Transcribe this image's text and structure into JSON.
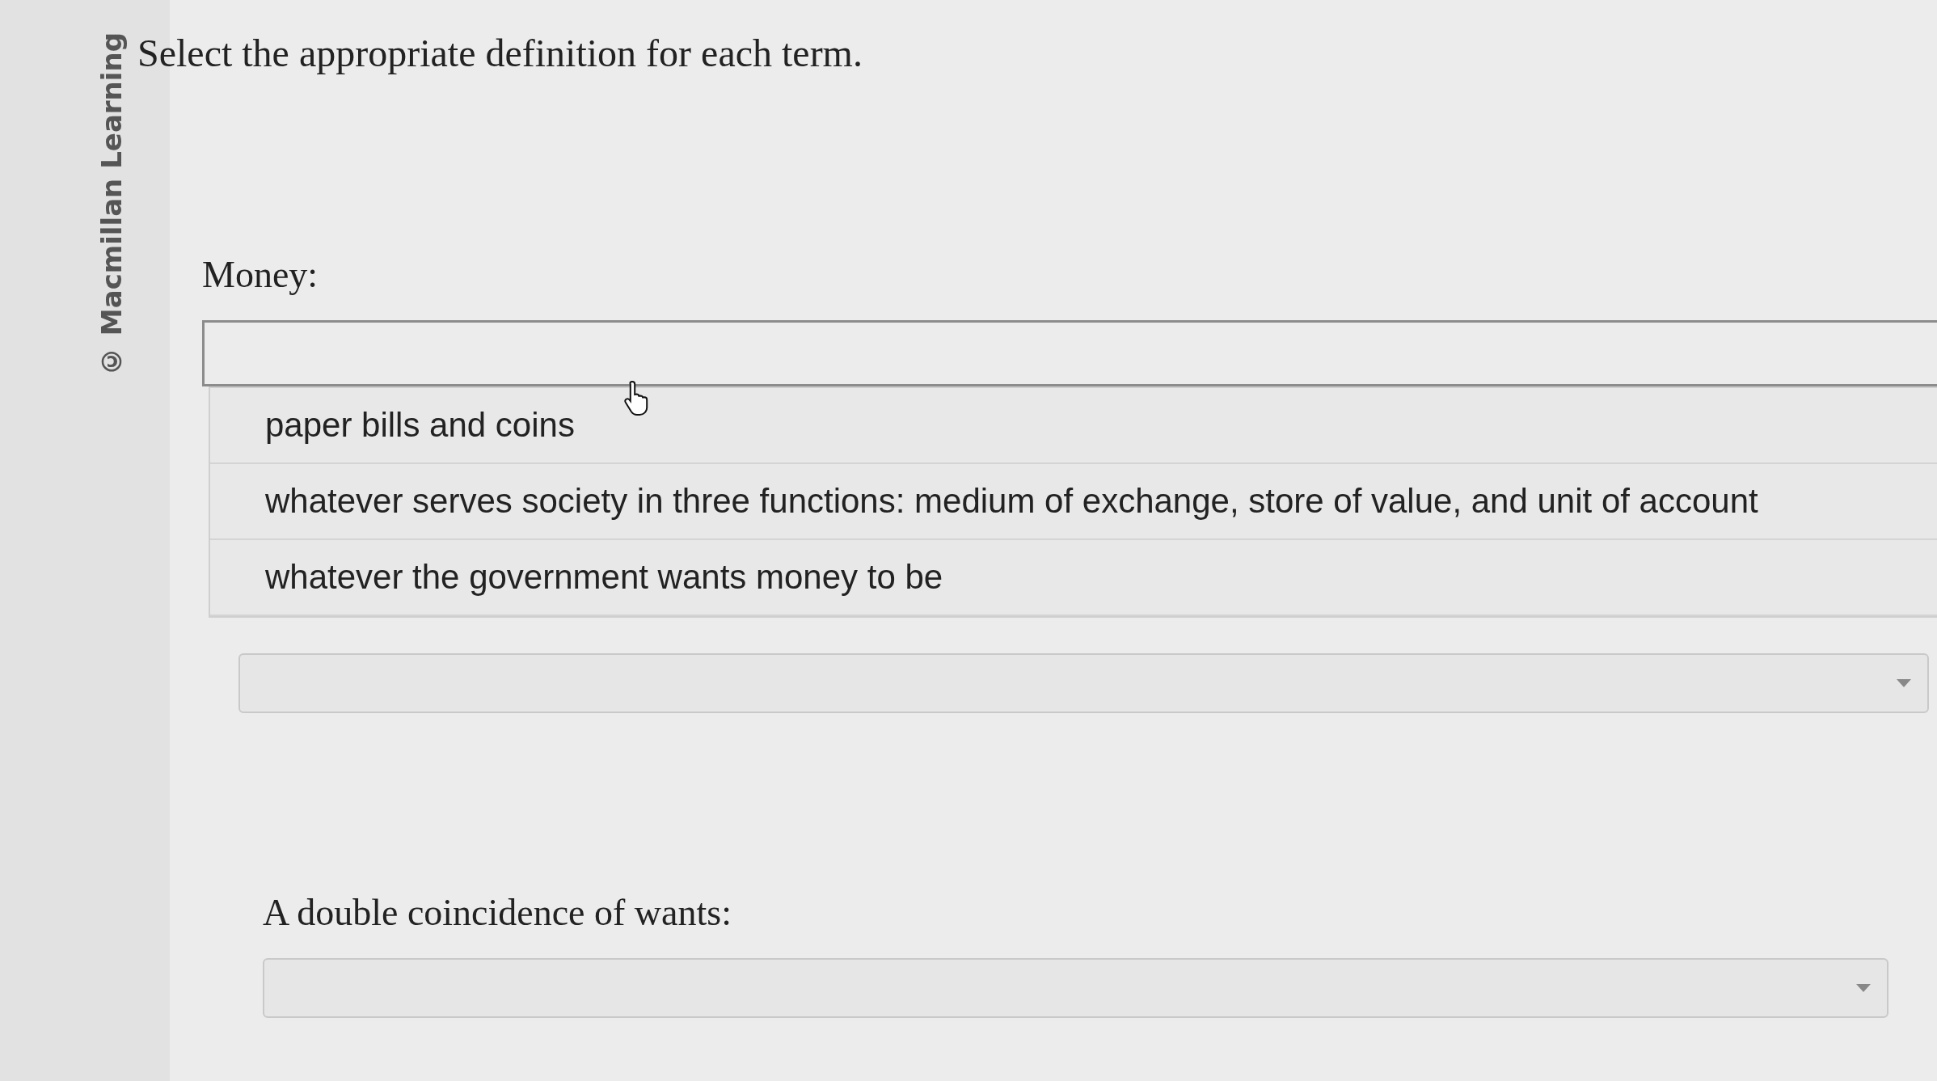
{
  "watermark_side": {
    "text": "© Macmillan Learning"
  },
  "instruction": "Select the appropriate definition for each term.",
  "terms": [
    {
      "label": "Money:",
      "expanded": true,
      "options": [
        {
          "text": "paper bills and coins",
          "selected": false
        },
        {
          "text": "whatever serves society in three functions: medium of exchange, store of value, and unit of account",
          "selected": false
        },
        {
          "text": "whatever the government wants money to be",
          "selected": false
        }
      ]
    },
    {
      "expanded": false
    },
    {
      "label": "A double coincidence of wants:",
      "expanded": false
    }
  ]
}
